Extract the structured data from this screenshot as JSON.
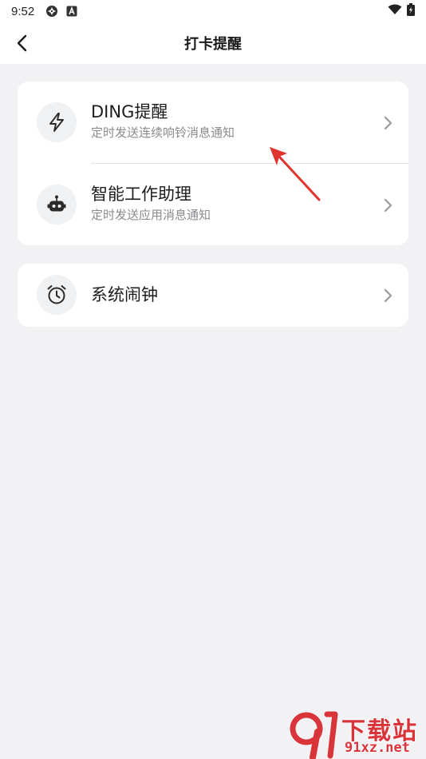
{
  "status_bar": {
    "time": "9:52",
    "icons": [
      "aperture-icon",
      "a-badge-icon",
      "wifi-icon",
      "battery-charging-icon"
    ]
  },
  "nav": {
    "title": "打卡提醒",
    "back_icon": "back-arrow-icon"
  },
  "groups": [
    {
      "items": [
        {
          "icon": "lightning-icon",
          "title": "DING提醒",
          "subtitle": "定时发送连续响铃消息通知"
        },
        {
          "icon": "robot-icon",
          "title": "智能工作助理",
          "subtitle": "定时发送应用消息通知"
        }
      ]
    },
    {
      "items": [
        {
          "icon": "alarm-clock-icon",
          "title": "系统闹钟"
        }
      ]
    }
  ],
  "annotation": {
    "color": "#e0342f"
  },
  "watermark": {
    "top": "下载站",
    "bottom": "91xz.net",
    "color": "#d8343a"
  }
}
